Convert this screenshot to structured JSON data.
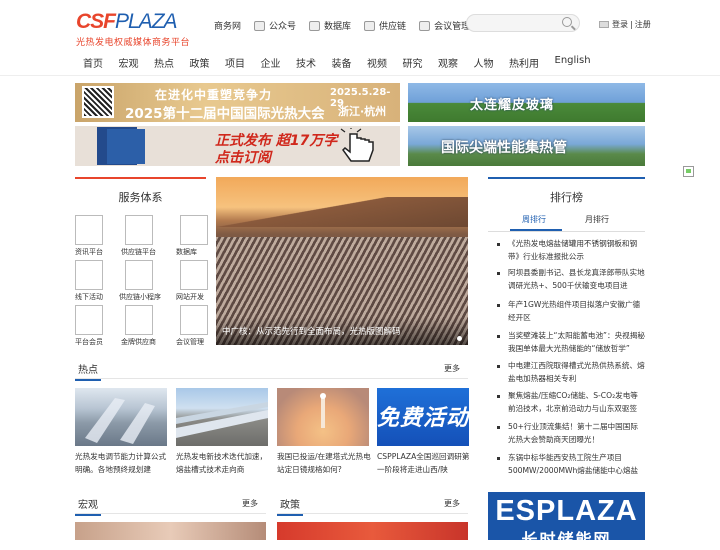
{
  "logo": {
    "mark_a": "CSF",
    "mark_b": "PLAZA",
    "tagline": "光热发电权威媒体商务平台"
  },
  "topnav": [
    {
      "label": "商务网",
      "icon": "none"
    },
    {
      "label": "公众号",
      "icon": "wechat-icon"
    },
    {
      "label": "数据库",
      "icon": "database-icon"
    },
    {
      "label": "供应链",
      "icon": "supply-chain-icon"
    },
    {
      "label": "会议管理",
      "icon": "meeting-icon"
    }
  ],
  "search": {
    "placeholder": ""
  },
  "login": {
    "login": "登录",
    "sep": "|",
    "register": "注册"
  },
  "mainnav": [
    "首页",
    "宏观",
    "热点",
    "政策",
    "项目",
    "企业",
    "技术",
    "装备",
    "视频",
    "研究",
    "观察",
    "人物",
    "热利用",
    "English"
  ],
  "banners": {
    "b1": {
      "line1": "在进化中重塑竞争力",
      "line2": "2025第十二届中国国际光热大会",
      "date": "2025.5.28-29",
      "place": "浙江·杭州"
    },
    "b2": {
      "text": "太连耀皮玻璃"
    },
    "b3": {
      "line1": "正式发布 超17万字",
      "line2": "点击订阅"
    },
    "b4": {
      "text": "国际尖端性能集热管"
    }
  },
  "services": {
    "title": "服务体系",
    "items": [
      "资讯平台",
      "供应链平台",
      "数据库",
      "线下活动",
      "供应链小程序",
      "网站开发",
      "平台会员",
      "金牌供应商",
      "会议管理"
    ]
  },
  "hero": {
    "caption": "中广核：从示范先行到全面布局，光热版图解码"
  },
  "ranking": {
    "title": "排行榜",
    "tabs": [
      "周排行",
      "月排行"
    ],
    "items": [
      "《光热发电熔盐储罐用不锈钢钢板和钢带》行业标准报批公示",
      "阿坝县委副书记、县长龙真泽郎带队实地调研光热+、500千伏输变电项目进",
      "年产1GW光热组件项目拟落户安徽广德经开区",
      "当奖壁滩装上“太阳能蓄电池”：央视揭秘我国单体最大光热储能的“储放哲学”",
      "中电建江西院取得槽式光热供热系统、熔盐电加热器相关专利",
      "聚焦熔盐/压缩CO₂储能、S-CO₂发电等前沿技术，北京前沿动力与山东双驱签",
      "50+行业顶流集结！第十二届中国国际光热大会赞助商天团曝光！",
      "东锅中标华能西安热工院生产项目500MW/2000MWh熔盐储能中心熔盐"
    ]
  },
  "ad": {
    "line1": "ESPLAZA",
    "line2": "长时储能网"
  },
  "hot": {
    "title": "热点",
    "more": "更多",
    "items": [
      "光热发电调节能力计算公式明确。各地预终规划建",
      "光热发电新技术迭代加速，熔盐槽式技术走向商",
      "我国已投运/在建塔式光热电站定日镜规格如何?",
      "CSPPLAZA全国巡回调研第一阶段将走进山西/陕"
    ],
    "badge_text": "免费活动"
  },
  "macro": {
    "title": "宏观",
    "more": "更多"
  },
  "policy": {
    "title": "政策",
    "more": "更多"
  },
  "colors": {
    "accent_red": "#e8452c",
    "accent_blue": "#1f5fb0"
  }
}
